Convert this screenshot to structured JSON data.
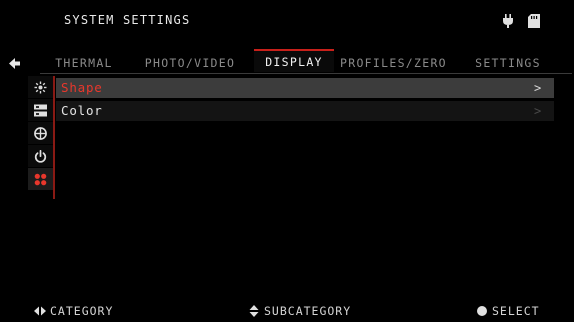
{
  "header": {
    "title": "SYSTEM SETTINGS",
    "status_icons": [
      "power-plug-icon",
      "sd-card-icon"
    ]
  },
  "tabs": [
    {
      "label": "THERMAL",
      "active": false
    },
    {
      "label": "PHOTO/VIDEO",
      "active": false
    },
    {
      "label": "DISPLAY",
      "active": true
    },
    {
      "label": "PROFILES/ZERO",
      "active": false
    },
    {
      "label": "SETTINGS",
      "active": false
    }
  ],
  "sidebar": {
    "items": [
      {
        "icon": "brightness-icon"
      },
      {
        "icon": "list-icon"
      },
      {
        "icon": "globe-icon"
      },
      {
        "icon": "power-icon"
      },
      {
        "icon": "grid-dots-icon",
        "active": true
      }
    ]
  },
  "list": {
    "items": [
      {
        "label": "Shape",
        "selected": true,
        "chevron": ">"
      },
      {
        "label": "Color",
        "selected": false,
        "chevron": ">"
      }
    ]
  },
  "footer": {
    "category": "CATEGORY",
    "subcategory": "SUBCATEGORY",
    "select": "SELECT"
  },
  "colors": {
    "accent": "#c8201a",
    "selected_text": "#e8372c",
    "background": "#000000"
  }
}
